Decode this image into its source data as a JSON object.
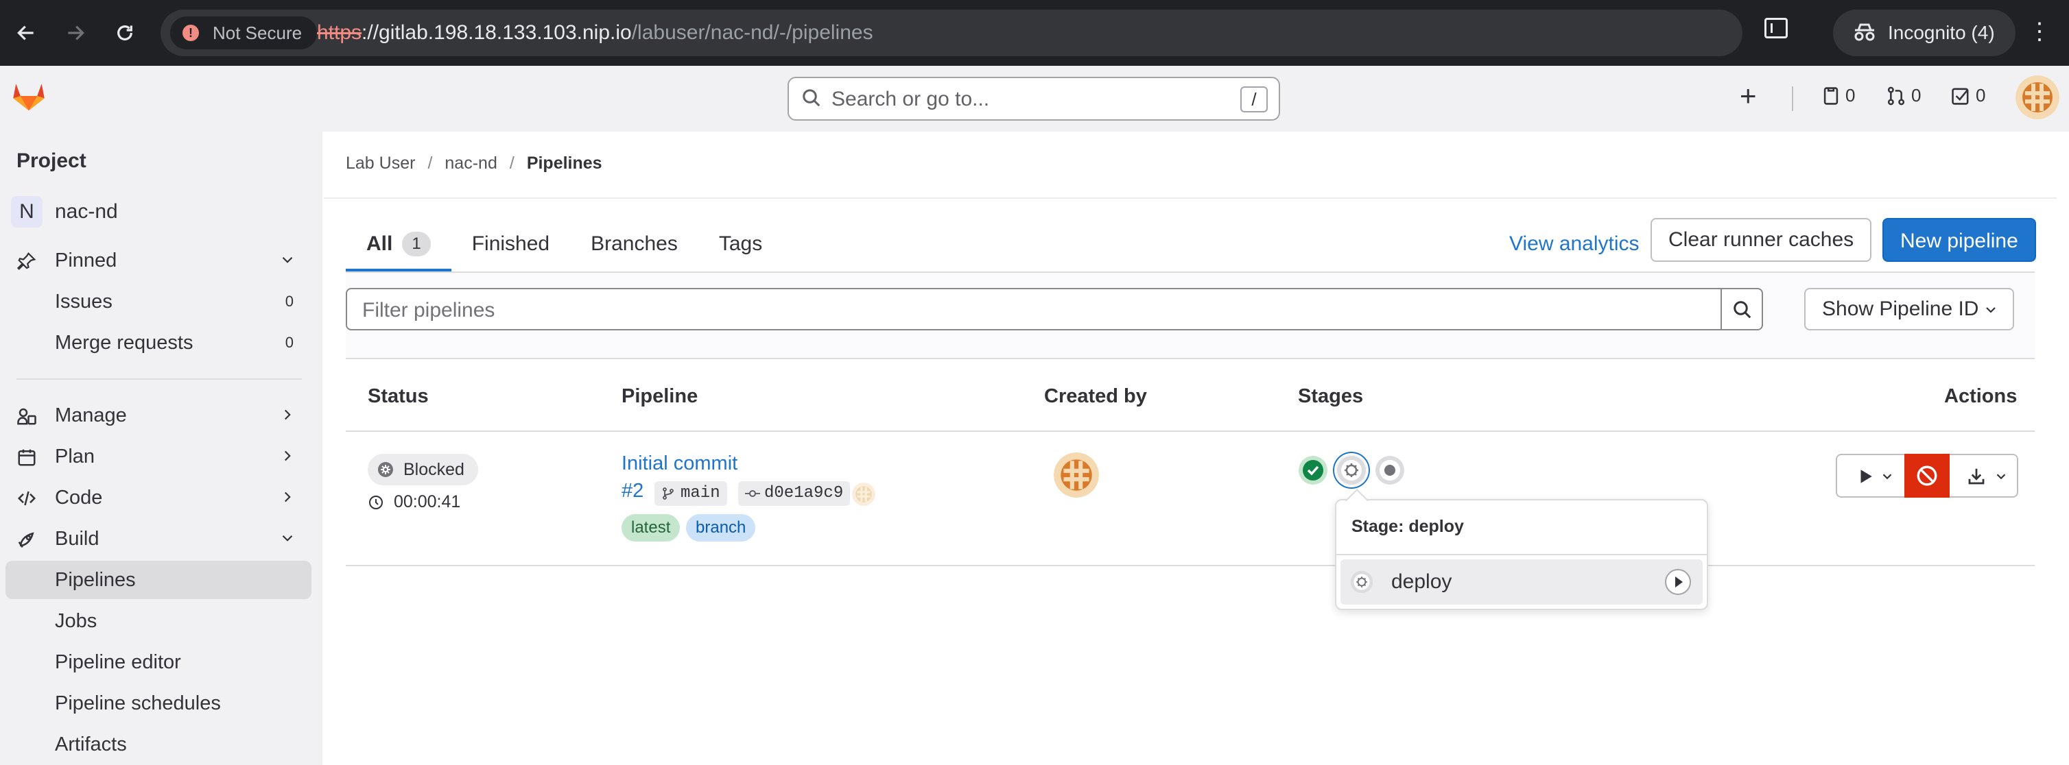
{
  "browser": {
    "security_label": "Not Secure",
    "url_scheme": "https",
    "url_host": "://gitlab.198.18.133.103.nip.io",
    "url_path": "/labuser/nac-nd/-/pipelines",
    "incognito_label": "Incognito (4)"
  },
  "topbar": {
    "search_placeholder": "Search or go to...",
    "search_shortcut": "/",
    "issues_count": "0",
    "mr_count": "0",
    "todo_count": "0"
  },
  "sidebar": {
    "section_title": "Project",
    "project_initial": "N",
    "project_name": "nac-nd",
    "items": [
      {
        "label": "Pinned"
      },
      {
        "label": "Issues",
        "count": "0"
      },
      {
        "label": "Merge requests",
        "count": "0"
      },
      {
        "label": "Manage"
      },
      {
        "label": "Plan"
      },
      {
        "label": "Code"
      },
      {
        "label": "Build"
      },
      {
        "label": "Pipelines"
      },
      {
        "label": "Jobs"
      },
      {
        "label": "Pipeline editor"
      },
      {
        "label": "Pipeline schedules"
      },
      {
        "label": "Artifacts"
      }
    ]
  },
  "breadcrumb": {
    "items": [
      "Lab User",
      "nac-nd",
      "Pipelines"
    ],
    "separator": "/"
  },
  "tabs": [
    {
      "label": "All",
      "count": "1"
    },
    {
      "label": "Finished"
    },
    {
      "label": "Branches"
    },
    {
      "label": "Tags"
    }
  ],
  "header_actions": {
    "analytics": "View analytics",
    "clear_caches": "Clear runner caches",
    "new_pipeline": "New pipeline"
  },
  "filter": {
    "placeholder": "Filter pipelines",
    "show_id": "Show Pipeline ID"
  },
  "table": {
    "columns": [
      "Status",
      "Pipeline",
      "Created by",
      "Stages",
      "Actions"
    ],
    "rows": [
      {
        "status": "Blocked",
        "duration": "00:00:41",
        "commit_title": "Initial commit",
        "pipeline_id": "#2",
        "branch": "main",
        "sha": "d0e1a9c9",
        "tags": [
          "latest",
          "branch"
        ]
      }
    ]
  },
  "popover": {
    "title": "Stage: deploy",
    "job_name": "deploy"
  },
  "colors": {
    "primary": "#1f75cb",
    "success": "#108548",
    "danger": "#dd2b0e",
    "neutral": "#737278"
  }
}
